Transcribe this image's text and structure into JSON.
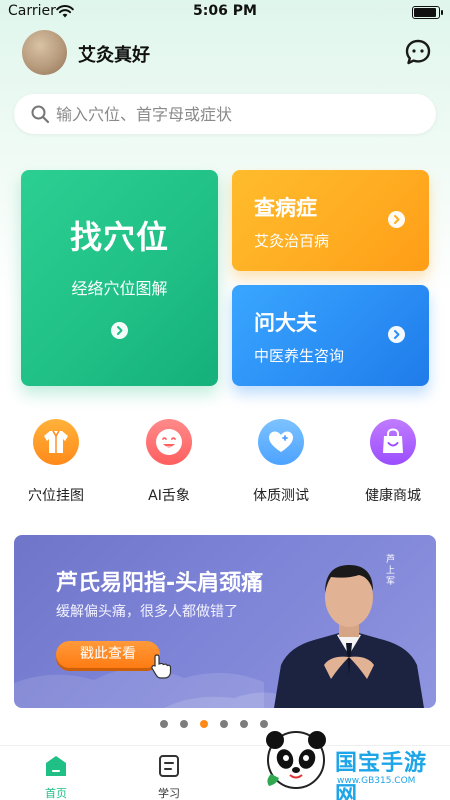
{
  "status_bar": {
    "carrier": "Carrier",
    "time": "5:06 PM"
  },
  "header": {
    "username": "艾灸真好"
  },
  "search": {
    "placeholder": "输入穴位、首字母或症状"
  },
  "cards": {
    "main": {
      "title": "找穴位",
      "subtitle": "经络穴位图解",
      "color": "#1fbf86"
    },
    "symptom": {
      "title": "查病症",
      "subtitle": "艾灸治百病",
      "color": "#ffad22"
    },
    "doctor": {
      "title": "问大夫",
      "subtitle": "中医养生咨询",
      "color": "#2b8ff5"
    }
  },
  "quick_actions": [
    {
      "label": "穴位挂图",
      "icon": "robe-icon"
    },
    {
      "label": "AI舌象",
      "icon": "tongue-face-icon"
    },
    {
      "label": "体质测试",
      "icon": "heart-icon"
    },
    {
      "label": "健康商城",
      "icon": "shopping-bag-icon"
    }
  ],
  "banner": {
    "title": "芦氏易阳指-头肩颈痛",
    "subtitle": "缓解偏头痛，很多人都做错了",
    "cta": "戳此查看",
    "side_text": "芦上军"
  },
  "carousel": {
    "count": 6,
    "active_index": 2
  },
  "tabbar": {
    "items": [
      {
        "label": "首页",
        "icon": "home-icon",
        "active": true
      },
      {
        "label": "学习",
        "icon": "learn-icon",
        "active": false
      }
    ]
  },
  "watermark": {
    "title": "国宝手游网",
    "subtitle": "www.GB315.COM"
  }
}
